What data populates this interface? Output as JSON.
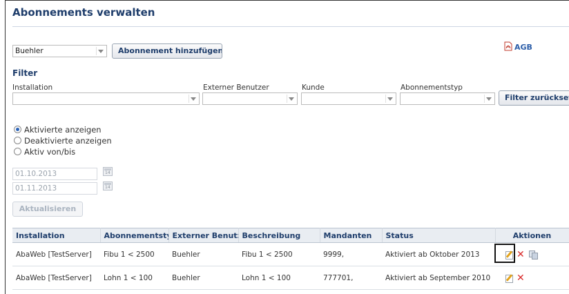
{
  "page": {
    "title": "Abonnements verwalten"
  },
  "user_select": {
    "value": "Buehler"
  },
  "add_button": {
    "label": "Abonnement hinzufügen"
  },
  "agb": {
    "label": "AGB"
  },
  "filter": {
    "heading": "Filter",
    "installation_label": "Installation",
    "external_user_label": "Externer Benutzer",
    "customer_label": "Kunde",
    "subscription_type_label": "Abonnementstyp",
    "reset_button": "Filter zurücksetzen"
  },
  "radios": [
    {
      "label": "Aktivierte anzeigen",
      "checked": true
    },
    {
      "label": "Deaktivierte anzeigen",
      "checked": false
    },
    {
      "label": "Aktiv von/bis",
      "checked": false
    }
  ],
  "dates": {
    "from": "01.10.2013",
    "to": "01.11.2013"
  },
  "refresh_button": {
    "label": "Aktualisieren"
  },
  "table": {
    "columns": [
      "Installation",
      "Abonnementstyp",
      "Externer Benutzer",
      "Beschreibung",
      "Mandanten",
      "Status",
      "Aktionen"
    ],
    "rows": [
      {
        "installation": "AbaWeb [TestServer]",
        "type": "Fibu 1 < 2500",
        "user": "Buehler",
        "description": "Fibu 1 < 2500",
        "mandanten": "9999,",
        "status": "Aktiviert ab Oktober 2013",
        "actions": [
          "edit-icon",
          "delete-icon",
          "copy-icon"
        ]
      },
      {
        "installation": "AbaWeb [TestServer]",
        "type": "Lohn 1 < 100",
        "user": "Buehler",
        "description": "Lohn 1 < 100",
        "mandanten": "777701,",
        "status": "Aktiviert ab September 2010",
        "actions": [
          "edit-icon",
          "delete-icon"
        ]
      }
    ]
  },
  "colors": {
    "heading": "#1e3d6b",
    "link": "#2b5da8",
    "delete": "#d92b2b",
    "table_header_bg": "#e9edf2"
  }
}
